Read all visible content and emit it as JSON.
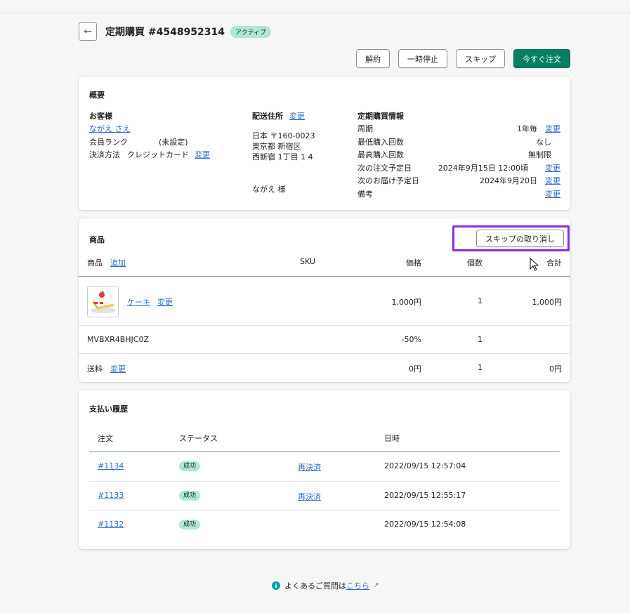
{
  "header": {
    "back_icon": "arrow-left-icon",
    "title": "定期購買 #4548952314",
    "status_badge": "アクティブ"
  },
  "actions": {
    "cancel": "解約",
    "pause": "一時停止",
    "skip": "スキップ",
    "order_now": "今すぐ注文"
  },
  "summary": {
    "title": "概要",
    "customer": {
      "heading": "お客様",
      "name": "ながえ さえ",
      "rank_label": "会員ランク",
      "rank_value": "(未設定)",
      "payment_label": "決済方法",
      "payment_value": "クレジットカード",
      "change": "変更"
    },
    "shipping": {
      "heading": "配送住所",
      "change": "変更",
      "address_lines": [
        "日本 〒160-0023",
        "東京都 新宿区",
        "西新宿 1丁目 1 4"
      ],
      "recipient": "ながえ 様"
    },
    "subscription": {
      "heading": "定期購買情報",
      "rows": [
        {
          "label": "周期",
          "value": "1年毎",
          "change": "変更"
        },
        {
          "label": "最低購入回数",
          "value": "なし",
          "change": ""
        },
        {
          "label": "最高購入回数",
          "value": "無制限",
          "change": ""
        },
        {
          "label": "次の注文予定日",
          "value": "2024年9月15日 12:00頃",
          "change": "変更"
        },
        {
          "label": "次のお届け予定日",
          "value": "2024年9月20日",
          "change": "変更"
        },
        {
          "label": "備考",
          "value": "",
          "change": "変更"
        }
      ]
    }
  },
  "products": {
    "title": "商品",
    "undo_skip": "スキップの取り消し",
    "columns": {
      "product": "商品",
      "add": "追加",
      "sku": "SKU",
      "price": "価格",
      "qty": "個数",
      "total": "合計"
    },
    "item": {
      "name": "ケーキ",
      "change": "変更",
      "price": "1,000円",
      "qty": "1",
      "total": "1,000円"
    },
    "discount": {
      "code": "MVBXR4BHJC0Z",
      "price": "-50%",
      "qty": "1"
    },
    "shipping": {
      "label": "送料",
      "change": "変更",
      "price": "0円",
      "qty": "1",
      "total": "0円"
    }
  },
  "payments": {
    "title": "支払い履歴",
    "columns": {
      "order": "注文",
      "status": "ステータス",
      "datetime": "日時"
    },
    "rows": [
      {
        "order": "#1134",
        "status": "成功",
        "action": "再決済",
        "datetime": "2022/09/15 12:57:04"
      },
      {
        "order": "#1133",
        "status": "成功",
        "action": "再決済",
        "datetime": "2022/09/15 12:55:17"
      },
      {
        "order": "#1132",
        "status": "成功",
        "action": "",
        "datetime": "2022/09/15 12:54:08"
      }
    ]
  },
  "footer": {
    "info_icon": "info-icon",
    "text": "よくあるご質問は",
    "link": "こちら",
    "external_icon": "external-link-icon"
  },
  "colors": {
    "primary": "#008060",
    "link": "#2c6ecb",
    "success_badge": "#aee9d1",
    "highlight": "#8a2be2"
  }
}
